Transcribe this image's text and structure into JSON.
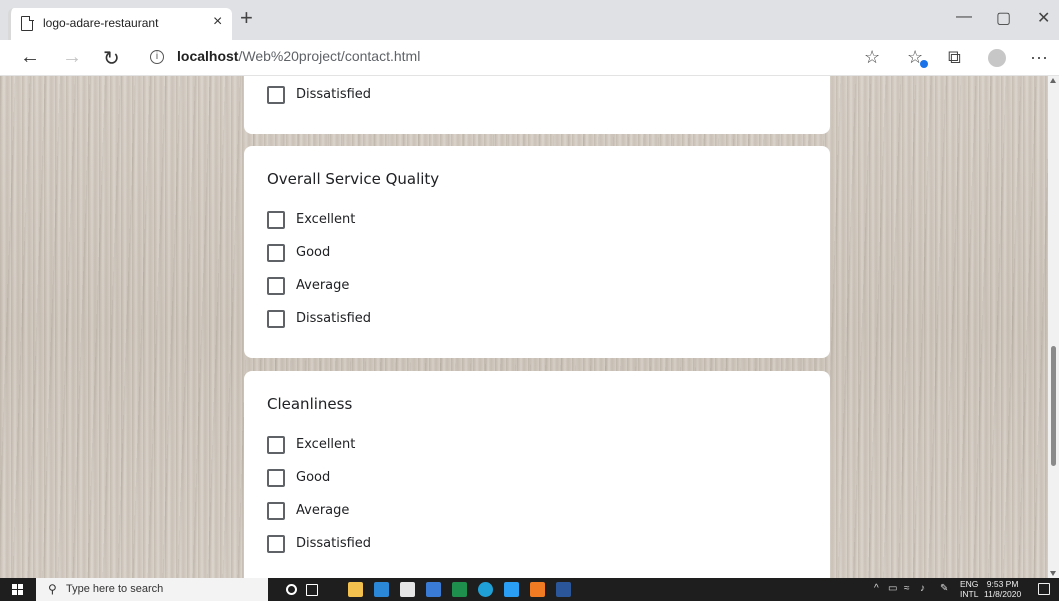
{
  "browser": {
    "tab_title": "logo-adare-restaurant",
    "tab_close": "×",
    "new_tab": "+",
    "window_controls": {
      "minimize": "—",
      "maximize": "▢",
      "close": "✕"
    },
    "url_host": "localhost",
    "url_path": "/Web%20project/contact.html",
    "info_glyph": "i",
    "more_glyph": "···"
  },
  "form": {
    "partial_card": {
      "options": [
        "Dissatisfied"
      ]
    },
    "sections": [
      {
        "title": "Overall Service Quality",
        "options": [
          "Excellent",
          "Good",
          "Average",
          "Dissatisfied"
        ]
      },
      {
        "title": "Cleanliness",
        "options": [
          "Excellent",
          "Good",
          "Average",
          "Dissatisfied"
        ]
      }
    ]
  },
  "taskbar": {
    "search_placeholder": "Type here to search",
    "language_line1": "ENG",
    "language_line2": "INTL",
    "time": "9:53 PM",
    "date": "11/8/2020"
  },
  "colors": {
    "edge_blue": "#1a73e8",
    "card_bg": "#ffffff",
    "taskbar_bg": "#1e1e1e"
  },
  "icons": {
    "taskbar_apps": [
      "cortana-icon",
      "task-view-icon",
      "file-explorer-icon",
      "mail-icon",
      "store-icon",
      "calendar-icon",
      "excel-icon",
      "edge-icon",
      "vscode-icon",
      "xampp-icon",
      "word-icon"
    ]
  }
}
